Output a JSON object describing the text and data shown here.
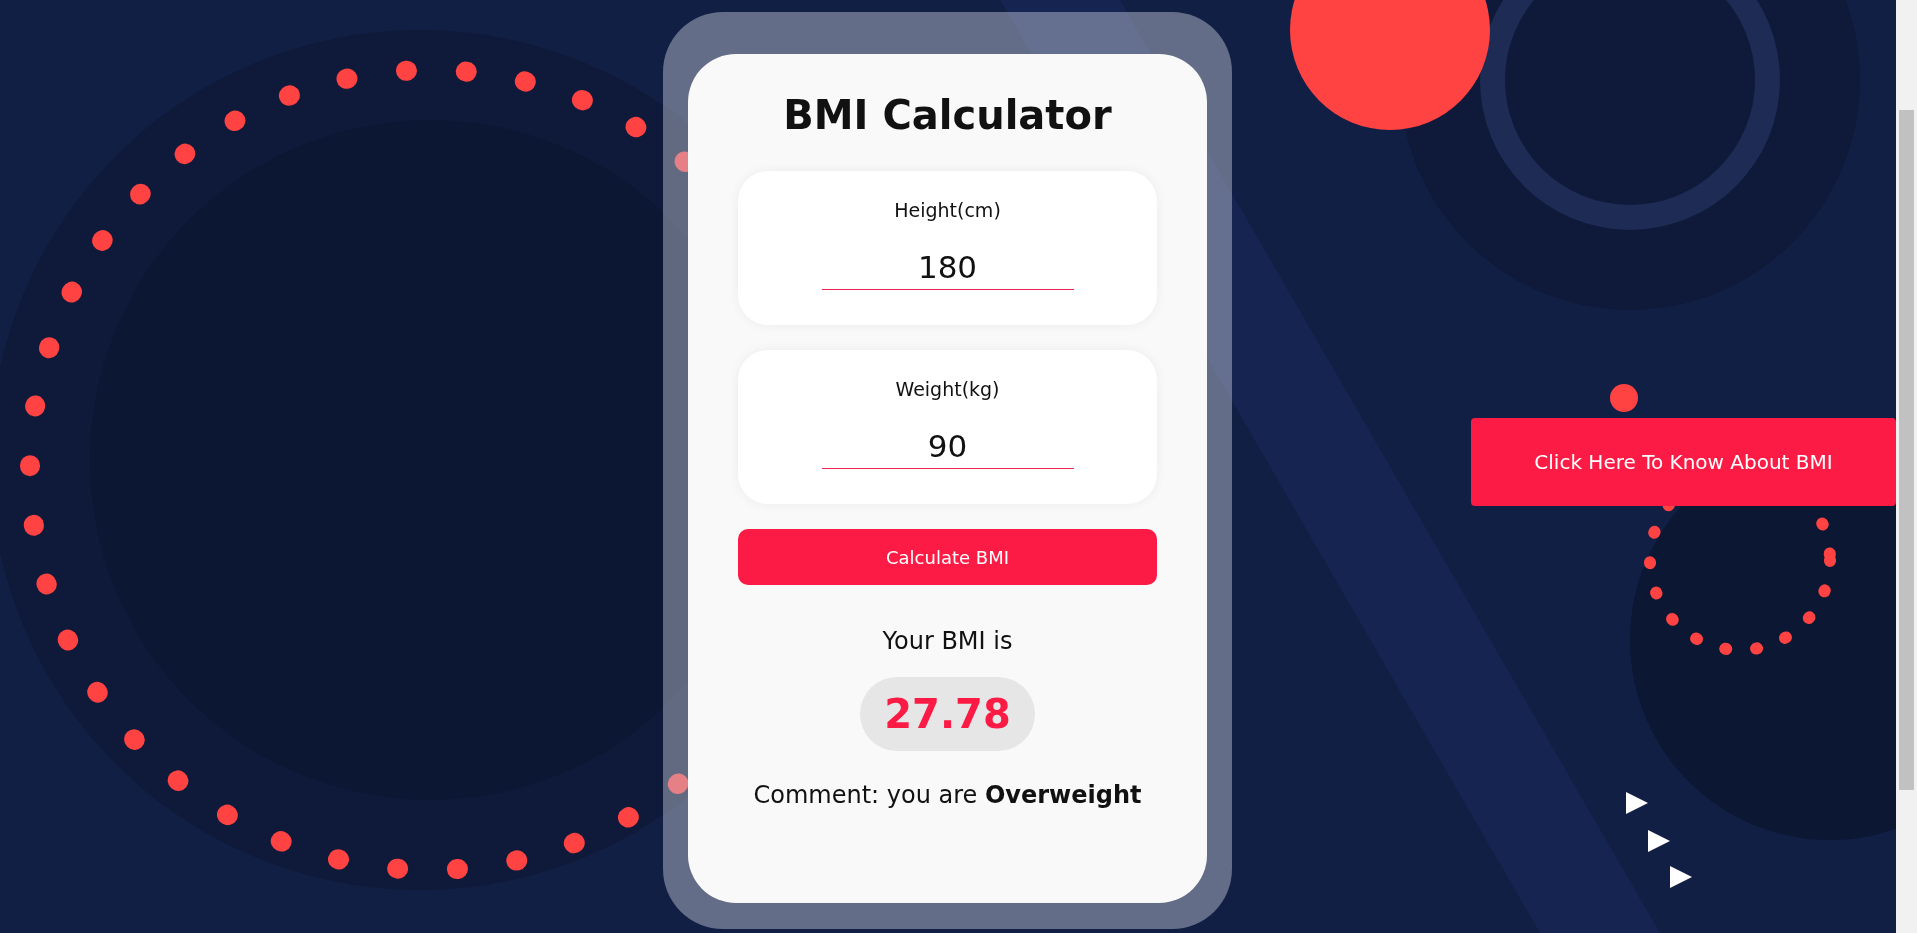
{
  "title": "BMI Calculator",
  "fields": [
    {
      "label": "Height(cm)",
      "value": "180"
    },
    {
      "label": "Weight(kg)",
      "value": "90"
    }
  ],
  "calculate_button": "Calculate BMI",
  "result": {
    "label": "Your BMI is",
    "value": "27.78"
  },
  "comment": "Comment: you are **Overweight**",
  "side_button": "Click Here To Know About BMI"
}
